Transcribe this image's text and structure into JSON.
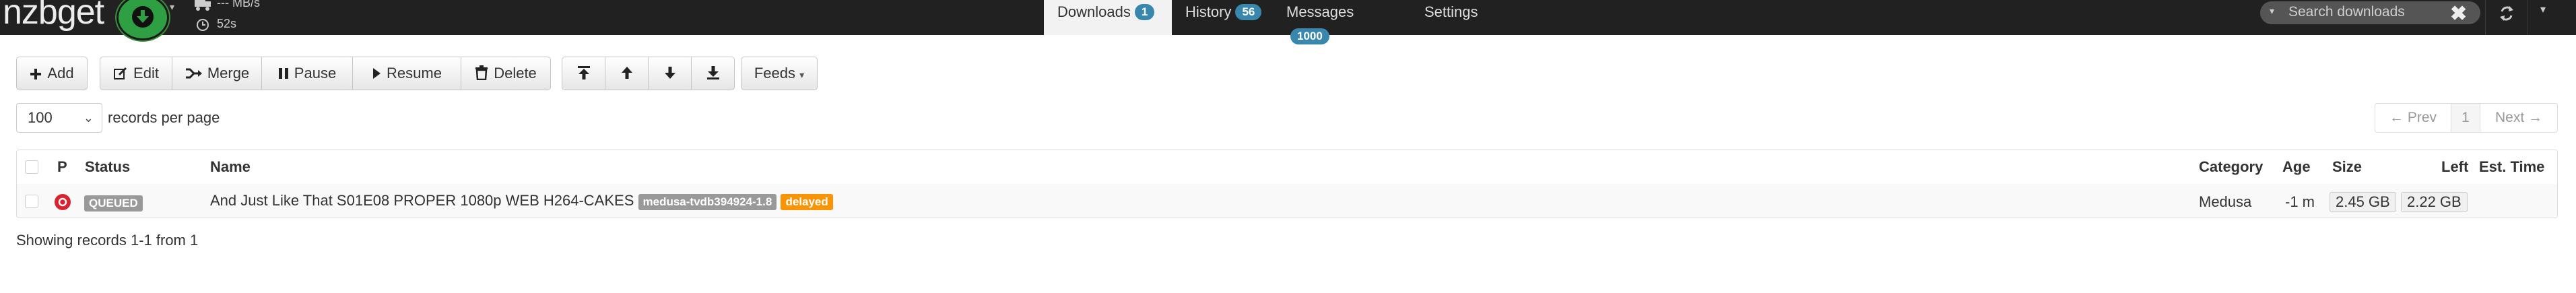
{
  "app": {
    "logo": "nzbget",
    "speed": "--- MB/s",
    "time": "52s"
  },
  "nav": {
    "tabs": [
      {
        "label": "Downloads",
        "badge": "1"
      },
      {
        "label": "History",
        "badge": "56"
      },
      {
        "label": "Messages",
        "badge": "1000"
      },
      {
        "label": "Settings",
        "badge": ""
      }
    ],
    "search_placeholder": "Search downloads"
  },
  "toolbar": {
    "add": "Add",
    "edit": "Edit",
    "merge": "Merge",
    "pause": "Pause",
    "resume": "Resume",
    "delete": "Delete",
    "feeds": "Feeds"
  },
  "paging": {
    "per_page_value": "100",
    "per_page_label": "records per page",
    "prev": "← Prev",
    "page": "1",
    "next": "Next →"
  },
  "table": {
    "headers": {
      "priority": "P",
      "status": "Status",
      "name": "Name",
      "category": "Category",
      "age": "Age",
      "size": "Size",
      "left": "Left",
      "est_time": "Est. Time"
    },
    "rows": [
      {
        "status": "QUEUED",
        "name": "And Just Like That S01E08 PROPER 1080p WEB H264-CAKES",
        "tag": "medusa-tvdb394924-1.8",
        "flag": "delayed",
        "category": "Medusa",
        "age": "-1 m",
        "size": "2.45 GB",
        "left": "2.22 GB",
        "est_time": ""
      }
    ],
    "footer": "Showing records 1-1 from 1"
  },
  "colors": {
    "navbar": "#212121",
    "download_button": "#2ea043",
    "badge": "#3a87ad",
    "queued_label": "#999999",
    "delayed_label": "#f89406",
    "priority_icon": "#d9232e"
  }
}
